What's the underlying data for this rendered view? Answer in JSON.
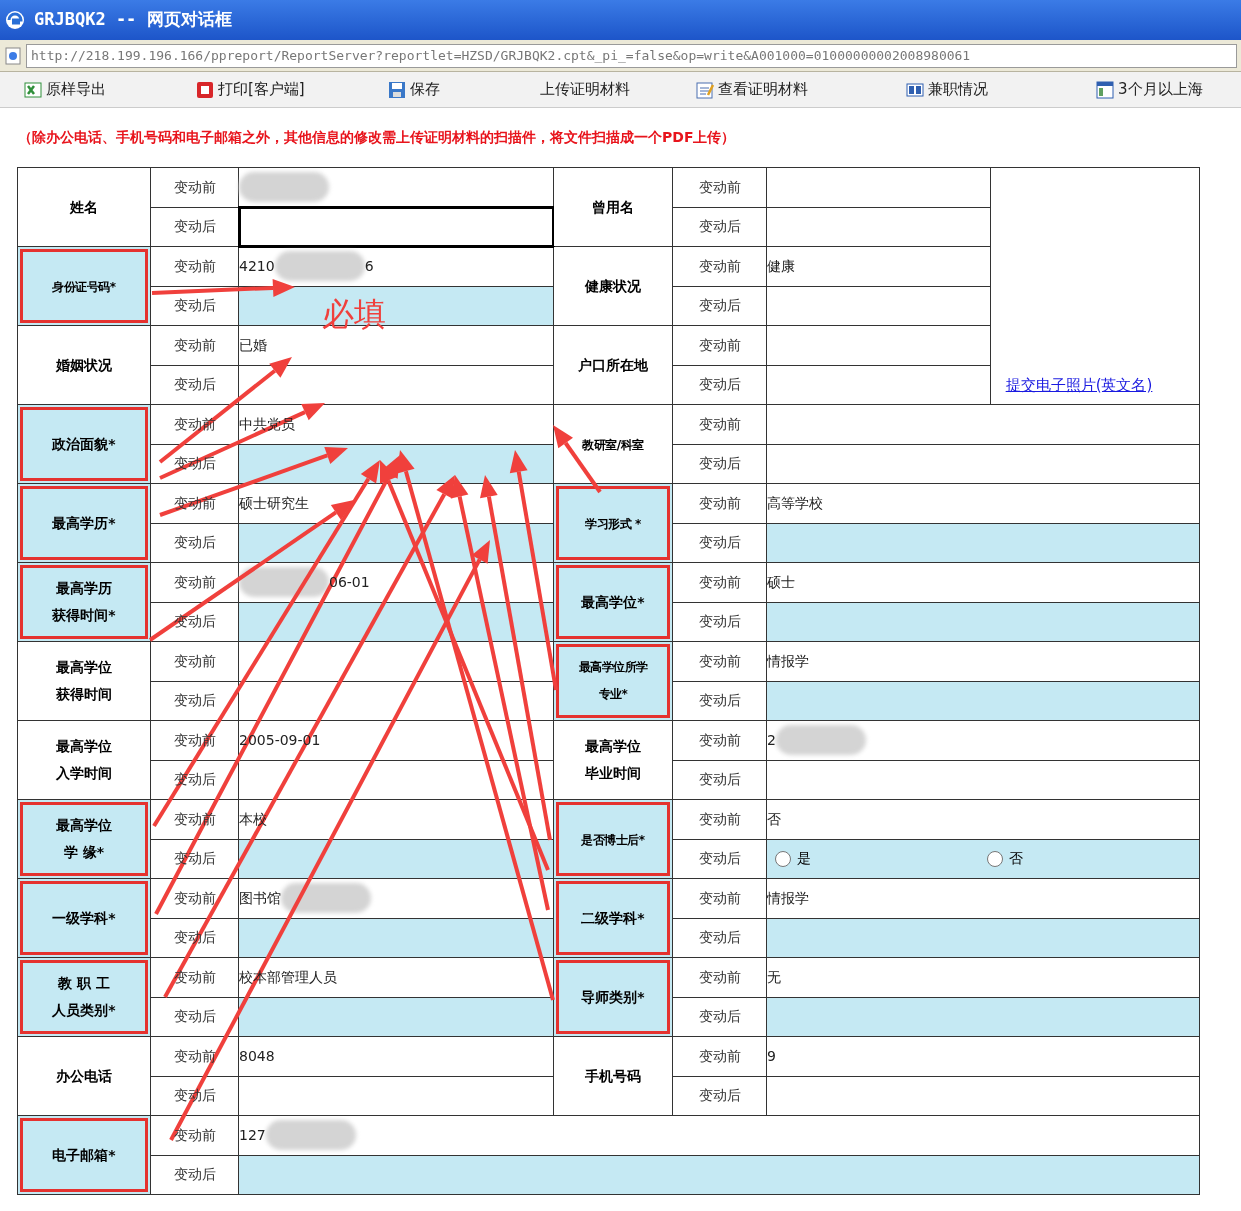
{
  "window": {
    "title": "GRJBQK2 -- 网页对话框"
  },
  "address_bar": {
    "url": "http://218.199.196.166/ppreport/ReportServer?reportlet=HZSD/GRJBQK2.cpt&_pi_=false&op=write&A001000=01000000002008980061"
  },
  "toolbar": [
    {
      "label": "原样导出"
    },
    {
      "label": "打印[客户端]"
    },
    {
      "label": "保存"
    },
    {
      "label": "上传证明材料"
    },
    {
      "label": "查看证明材料"
    },
    {
      "label": "兼职情况"
    },
    {
      "label": "3个月以上海"
    }
  ],
  "notice": "（除办公电话、手机号码和电子邮箱之外，其他信息的修改需上传证明材料的扫描件，将文件扫描成一个PDF上传）",
  "annotation": "必填",
  "photo_link": "提交电子照片(英文名)",
  "rows": [
    {
      "left": {
        "label": [
          "姓名"
        ],
        "required": false,
        "before_caption": "变动前",
        "after_caption": "变动后",
        "redacted": true,
        "after_focused": true
      },
      "right": {
        "label": [
          "曾用名"
        ],
        "required": false,
        "before_caption": "变动前",
        "after_caption": "变动后"
      }
    },
    {
      "left": {
        "label": [
          "身份证号码*"
        ],
        "required": true,
        "before_caption": "变动前",
        "after_caption": "变动后",
        "before": "4210",
        "redacted": true,
        "before_tail": "6"
      },
      "right": {
        "label": [
          "健康状况"
        ],
        "required": false,
        "before_caption": "变动前",
        "after_caption": "变动后",
        "before": "健康"
      }
    },
    {
      "left": {
        "label": [
          "婚姻状况"
        ],
        "required": false,
        "before_caption": "变动前",
        "after_caption": "变动后",
        "before": "已婚"
      },
      "right": {
        "label": [
          "户口所在地"
        ],
        "required": false,
        "before_caption": "变动前",
        "after_caption": "变动后"
      }
    },
    {
      "left": {
        "label": [
          "政治面貌*"
        ],
        "required": true,
        "before_caption": "变动前",
        "after_caption": "变动后",
        "before": "中共党员"
      },
      "right": {
        "label": [
          "教研室/科室"
        ],
        "required": false,
        "before_caption": "变动前",
        "after_caption": "变动后"
      }
    },
    {
      "left": {
        "label": [
          "最高学历*"
        ],
        "required": true,
        "before_caption": "变动前",
        "after_caption": "变动后",
        "before": "硕士研究生"
      },
      "right": {
        "label": [
          "学习形式 *"
        ],
        "required": true,
        "before_caption": "变动前",
        "after_caption": "变动后",
        "before": "高等学校"
      }
    },
    {
      "left": {
        "label": [
          "最高学历",
          "获得时间*"
        ],
        "required": true,
        "before_caption": "变动前",
        "after_caption": "变动后",
        "redacted": true,
        "before_tail": "06-01"
      },
      "right": {
        "label": [
          "最高学位*"
        ],
        "required": true,
        "before_caption": "变动前",
        "after_caption": "变动后",
        "before": "硕士"
      }
    },
    {
      "left": {
        "label": [
          "最高学位",
          "获得时间"
        ],
        "required": false,
        "before_caption": "变动前",
        "after_caption": "变动后"
      },
      "right": {
        "label": [
          "最高学位所学",
          "专业*"
        ],
        "required": true,
        "before_caption": "变动前",
        "after_caption": "变动后",
        "before": "情报学"
      }
    },
    {
      "left": {
        "label": [
          "最高学位",
          "入学时间"
        ],
        "required": false,
        "before_caption": "变动前",
        "after_caption": "变动后",
        "before": "2005-09-01"
      },
      "right": {
        "label": [
          "最高学位",
          "毕业时间"
        ],
        "required": false,
        "before_caption": "变动前",
        "after_caption": "变动后",
        "before": "2",
        "redacted": true
      }
    },
    {
      "left": {
        "label": [
          "最高学位",
          "学 缘*"
        ],
        "required": true,
        "before_caption": "变动前",
        "after_caption": "变动后",
        "before": "本校"
      },
      "right": {
        "label": [
          "是否博士后*"
        ],
        "required": true,
        "before_caption": "变动前",
        "after_caption": "变动后",
        "before": "否",
        "options": [
          {
            "label": "是",
            "selected": false
          },
          {
            "label": "否",
            "selected": false
          }
        ]
      }
    },
    {
      "left": {
        "label": [
          "一级学科*"
        ],
        "required": true,
        "before_caption": "变动前",
        "after_caption": "变动后",
        "before": "图书馆",
        "redacted": true
      },
      "right": {
        "label": [
          "二级学科*"
        ],
        "required": true,
        "before_caption": "变动前",
        "after_caption": "变动后",
        "before": "情报学"
      }
    },
    {
      "left": {
        "label": [
          "教 职 工",
          "人员类别*"
        ],
        "required": true,
        "before_caption": "变动前",
        "after_caption": "变动后",
        "before": "校本部管理人员"
      },
      "right": {
        "label": [
          "导师类别*"
        ],
        "required": true,
        "before_caption": "变动前",
        "after_caption": "变动后",
        "before": "无"
      }
    },
    {
      "left": {
        "label": [
          "办公电话"
        ],
        "required": false,
        "before_caption": "变动前",
        "after_caption": "变动后",
        "before": "8048"
      },
      "right": {
        "label": [
          "手机号码"
        ],
        "required": false,
        "before_caption": "变动前",
        "after_caption": "变动后",
        "before": "9"
      }
    },
    {
      "left": {
        "label": [
          "电子邮箱*"
        ],
        "required": true,
        "before_caption": "变动前",
        "after_caption": "变动后",
        "before": "127",
        "redacted": true
      }
    }
  ]
}
